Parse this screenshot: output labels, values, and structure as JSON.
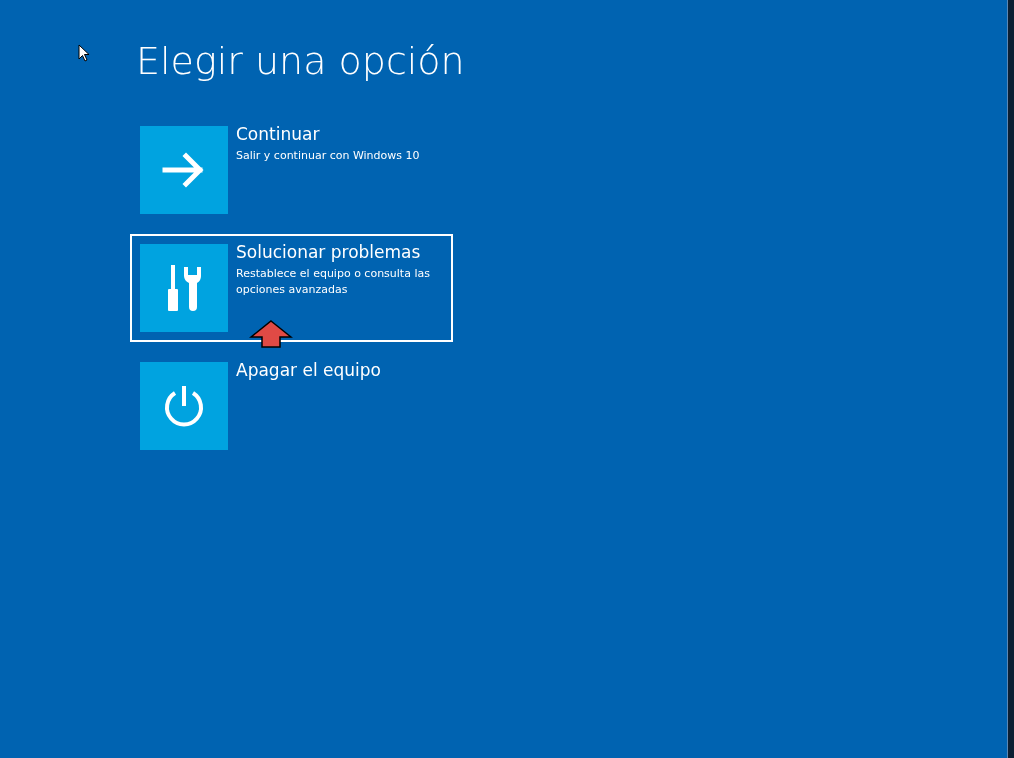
{
  "title": "Elegir una opción",
  "options": [
    {
      "kind": "continue",
      "label": "Continuar",
      "description": "Salir y continuar con Windows 10",
      "selected": false
    },
    {
      "kind": "troubleshoot",
      "label": "Solucionar problemas",
      "description": "Restablece el equipo o consulta las opciones avanzadas",
      "selected": true
    },
    {
      "kind": "power",
      "label": "Apagar el equipo",
      "selected": false
    }
  ]
}
